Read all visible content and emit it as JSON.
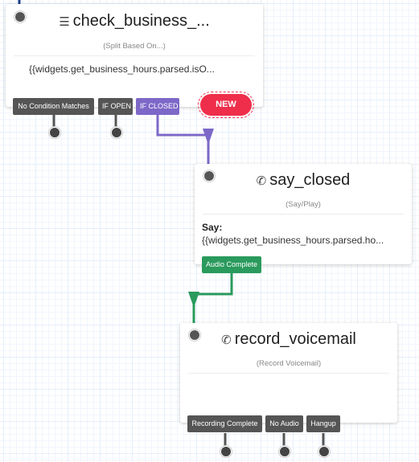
{
  "colors": {
    "entry_wire": "#1f3f8c",
    "closed_wire": "#7d68c8",
    "audio_wire": "#2a9a5d",
    "dark_wire": "#555555",
    "new_button": "#ee2e4a"
  },
  "widgets": [
    {
      "id": "check_business",
      "icon": "split-icon",
      "title": "check_business_...",
      "type": "(Split Based On...)",
      "body": "{{widgets.get_business_hours.parsed.isO...",
      "transitions": [
        "No Condition Matches",
        "IF OPEN",
        "IF CLOSED"
      ],
      "new_button": "NEW"
    },
    {
      "id": "say_closed",
      "icon": "phone-icon",
      "title": "say_closed",
      "type": "(Say/Play)",
      "body_label": "Say:",
      "body": "{{widgets.get_business_hours.parsed.ho...",
      "transitions": [
        "Audio Complete"
      ]
    },
    {
      "id": "record_voicemail",
      "icon": "phone-icon",
      "title": "record_voicemail",
      "type": "(Record Voicemail)",
      "transitions": [
        "Recording Complete",
        "No Audio",
        "Hangup"
      ]
    }
  ]
}
